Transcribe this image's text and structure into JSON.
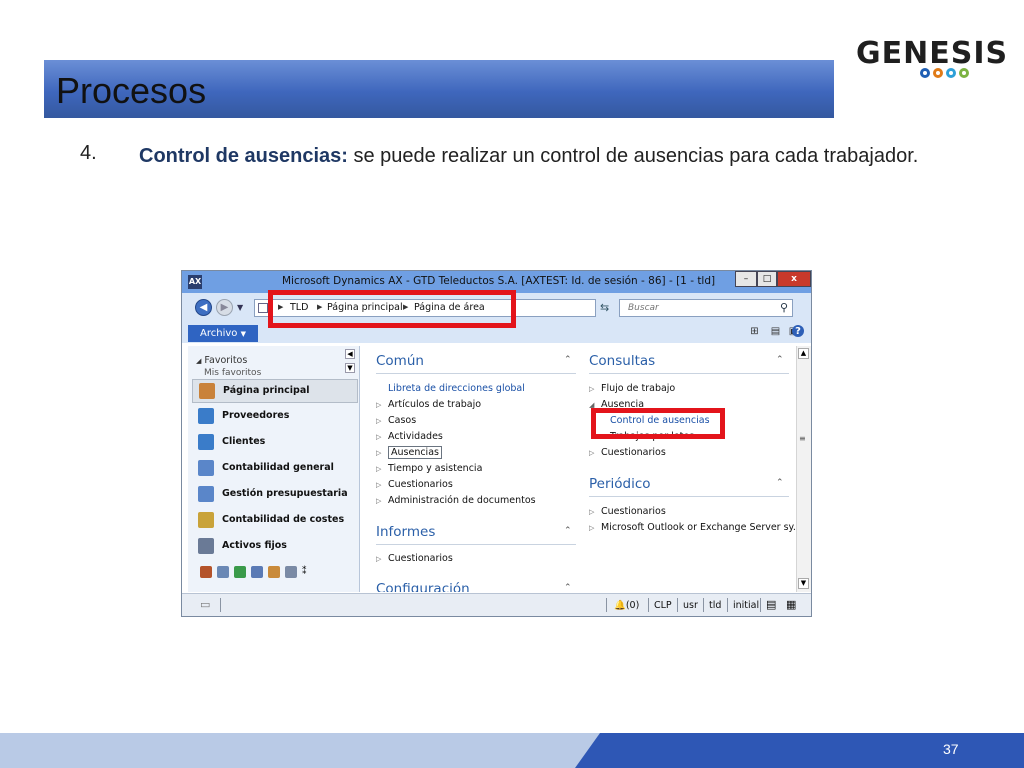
{
  "slide": {
    "title": "Procesos",
    "logo_text": "GENESIS",
    "logo_ring_colors": [
      "#1f5fb4",
      "#e07b18",
      "#2ea0d8",
      "#7cb342"
    ],
    "item_number": "4.",
    "item_bold": "Control de ausencias:",
    "item_rest": " se puede realizar un control de ausencias para cada trabajador.",
    "page_number": "37"
  },
  "window": {
    "title": "Microsoft Dynamics AX - GTD Teleductos S.A. [AXTEST: Id. de sesión - 86] - [1 - tld]",
    "app_icon": "AX",
    "minimize_label": "–",
    "maximize_label": "□",
    "close_label": "x",
    "breadcrumb": [
      "TLD",
      "Página principal",
      "Página de área"
    ],
    "search_placeholder": "Buscar",
    "archivo_label": "Archivo",
    "help_label": "?"
  },
  "navpane": {
    "favorites_label": "Favoritos",
    "my_favorites_label": "Mis favoritos",
    "modules": [
      {
        "label": "Página principal",
        "icon_color": "#c9823a"
      },
      {
        "label": "Proveedores",
        "icon_color": "#3a7cc9"
      },
      {
        "label": "Clientes",
        "icon_color": "#3a7cc9"
      },
      {
        "label": "Contabilidad general",
        "icon_color": "#5a86c9"
      },
      {
        "label": "Gestión presupuestaria",
        "icon_color": "#5a86c9"
      },
      {
        "label": "Contabilidad de costes",
        "icon_color": "#c9a33a"
      },
      {
        "label": "Activos fijos",
        "icon_color": "#6a7a96"
      }
    ],
    "mini_icon_colors": [
      "#b4532a",
      "#6a88b5",
      "#3a9a4a",
      "#5a7ab5",
      "#c98a3a",
      "#7a8aa5",
      "#555"
    ]
  },
  "content": {
    "comun": {
      "title": "Común",
      "links": [
        "Libreta de direcciones global",
        "Artículos de trabajo",
        "Casos",
        "Actividades",
        "Ausencias",
        "Tiempo y asistencia",
        "Cuestionarios",
        "Administración de documentos"
      ]
    },
    "informes": {
      "title": "Informes",
      "links": [
        "Cuestionarios"
      ]
    },
    "configuracion": {
      "title": "Configuración"
    },
    "consultas": {
      "title": "Consultas",
      "links": [
        "Flujo de trabajo",
        "Ausencia",
        "Control de ausencias",
        "Trabajos por lotes",
        "Cuestionarios"
      ]
    },
    "periodico": {
      "title": "Periódico",
      "links": [
        "Cuestionarios",
        "Microsoft Outlook or Exchange Server sy..."
      ]
    }
  },
  "statusbar": {
    "alerts": "(0)",
    "currency": "CLP",
    "user": "usr",
    "company": "tld",
    "layer": "initial"
  }
}
